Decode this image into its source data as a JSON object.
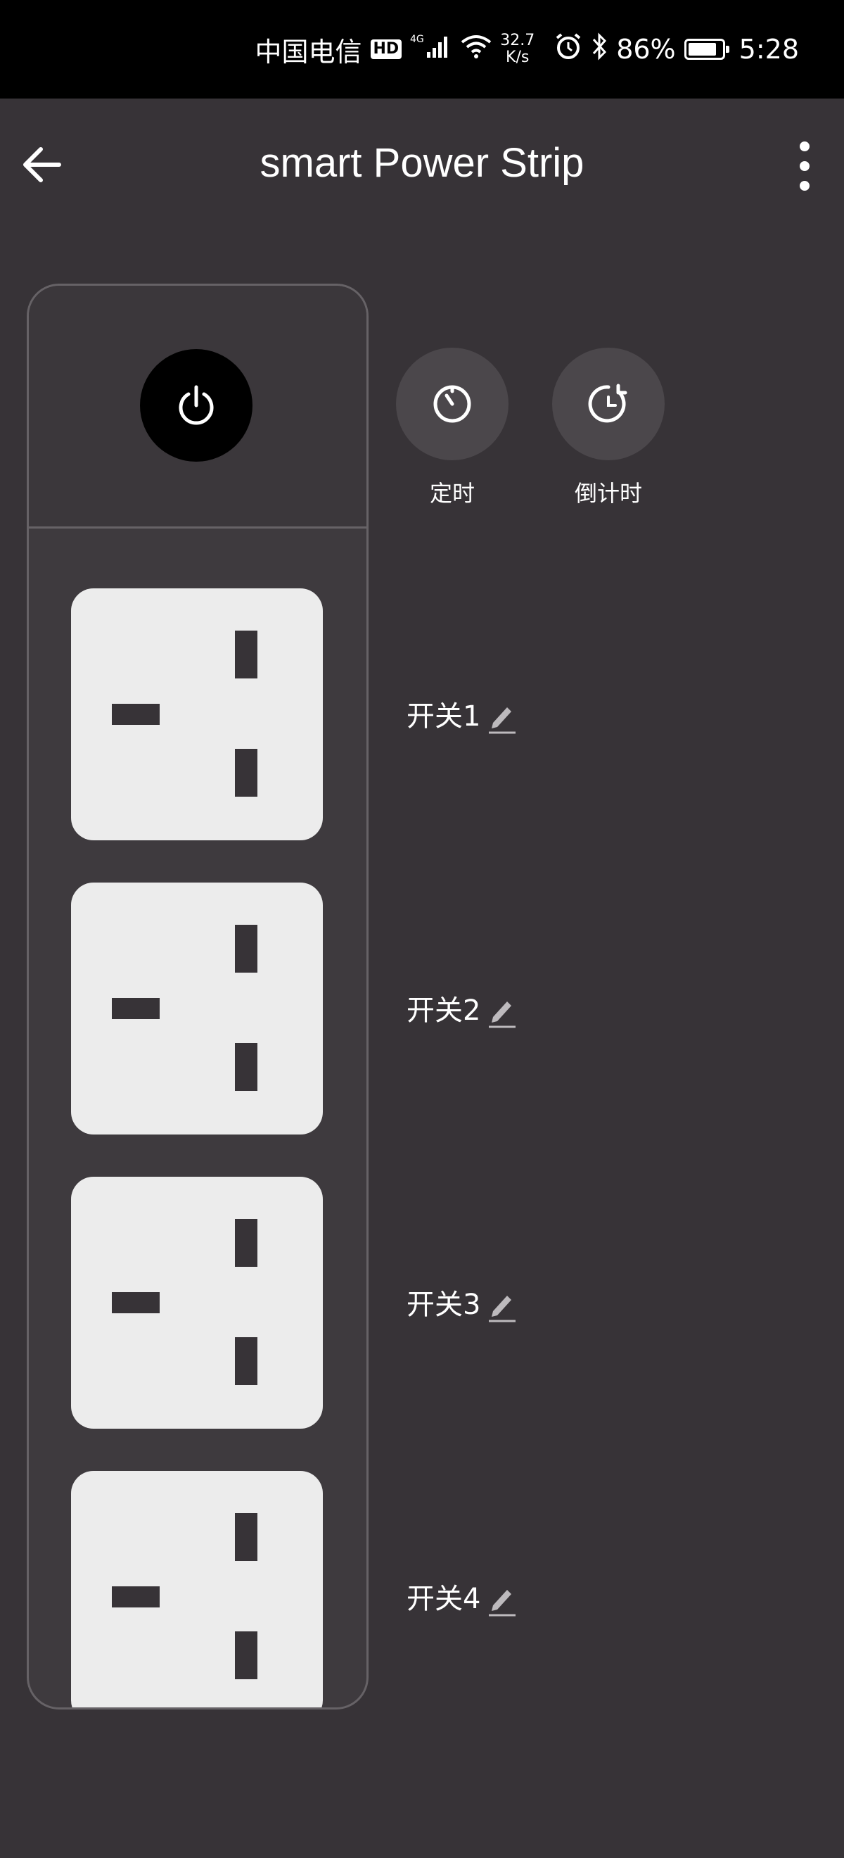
{
  "status_bar": {
    "carrier": "中国电信",
    "hd_badge": "HD",
    "network": "4G",
    "speed_value": "32.7",
    "speed_unit": "K/s",
    "battery_percent": "86%",
    "battery_level": 0.86,
    "time": "5:28"
  },
  "header": {
    "title": "smart Power Strip"
  },
  "actions": {
    "timer_label": "定时",
    "countdown_label": "倒计时"
  },
  "switches": [
    {
      "label": "开关1"
    },
    {
      "label": "开关2"
    },
    {
      "label": "开关3"
    },
    {
      "label": "开关4"
    }
  ],
  "colors": {
    "background": "#373337",
    "socket": "#ececec",
    "power_button": "#000000",
    "action_circle": "#4b474b"
  },
  "icons": {
    "back": "back-arrow-icon",
    "more": "more-vertical-icon",
    "power": "power-icon",
    "timer": "timer-icon",
    "countdown": "countdown-icon",
    "edit": "pencil-icon"
  }
}
